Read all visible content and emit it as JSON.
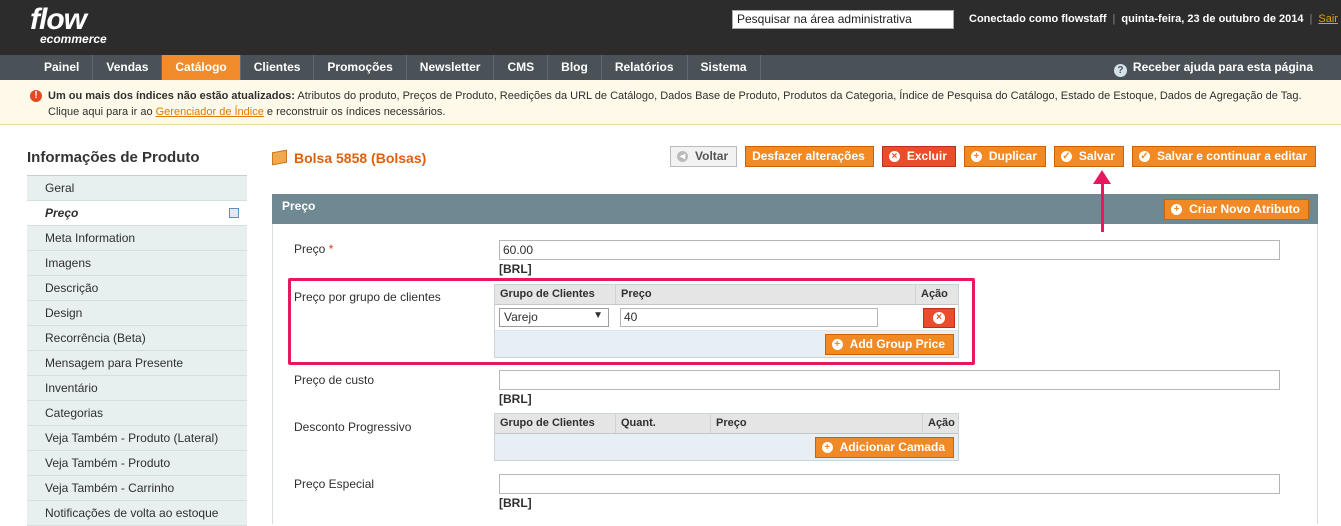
{
  "header": {
    "logo_top": "flow",
    "logo_bottom": "ecommerce",
    "search_placeholder": "Pesquisar na área administrativa",
    "user_text": "Conectado como flowstaff",
    "separator": "|",
    "date_text": "quinta-feira, 23 de outubro de 2014",
    "logout_label": "Sair"
  },
  "nav": {
    "items": [
      "Painel",
      "Vendas",
      "Catálogo",
      "Clientes",
      "Promoções",
      "Newsletter",
      "CMS",
      "Blog",
      "Relatórios",
      "Sistema"
    ],
    "active_index": 2,
    "help_label": "Receber ajuda para esta página",
    "help_icon": "question-icon"
  },
  "notice": {
    "icon": "error-icon",
    "bold_text": "Um ou mais dos índices não estão atualizados:",
    "text": " Atributos do produto, Preços de Produto, Reedições da URL de Catálogo, Dados Base de Produto, Produtos da Categoria, Índice de Pesquisa do Catálogo, Estado de Estoque, Dados de Agregação de Tag.",
    "line2_pre": "Clique aqui para ir ao ",
    "line2_link": "Gerenciador de Índice",
    "line2_post": " e reconstruir os índices necessários."
  },
  "sidebar": {
    "title": "Informações de Produto",
    "tabs": [
      "Geral",
      "Preço",
      "Meta Information",
      "Imagens",
      "Descrição",
      "Design",
      "Recorrência (Beta)",
      "Mensagem para Presente",
      "Inventário",
      "Categorias",
      "Veja Também - Produto (Lateral)",
      "Veja Também - Produto",
      "Veja Também - Carrinho",
      "Notificações de volta ao estoque"
    ],
    "active_index": 1
  },
  "page": {
    "title": "Bolsa 5858 (Bolsas)",
    "buttons": {
      "back": "Voltar",
      "reset": "Desfazer alterações",
      "delete": "Excluir",
      "duplicate": "Duplicar",
      "save": "Salvar",
      "save_continue": "Salvar e continuar a editar"
    },
    "section_title": "Preço",
    "create_attribute": "Criar Novo Atributo"
  },
  "form": {
    "price_label": "Preço",
    "price_required": "*",
    "price_value": "60.00",
    "currency": "[BRL]",
    "group_price_label": "Preço por grupo de clientes",
    "group_price_headers": [
      "Grupo de Clientes",
      "Preço",
      "Ação"
    ],
    "group_price_row": {
      "group": "Varejo",
      "price": "40"
    },
    "add_group_price": "Add Group Price",
    "cost_label": "Preço de custo",
    "cost_value": "",
    "tier_label": "Desconto Progressivo",
    "tier_headers": [
      "Grupo de Clientes",
      "Quant.",
      "Preço",
      "Ação"
    ],
    "add_tier": "Adicionar Camada",
    "special_label": "Preço Especial",
    "special_value": ""
  },
  "colors": {
    "accent": "#f18a24",
    "highlight": "#e8185f",
    "section": "#6f8992",
    "header": "#2c2c2c"
  }
}
